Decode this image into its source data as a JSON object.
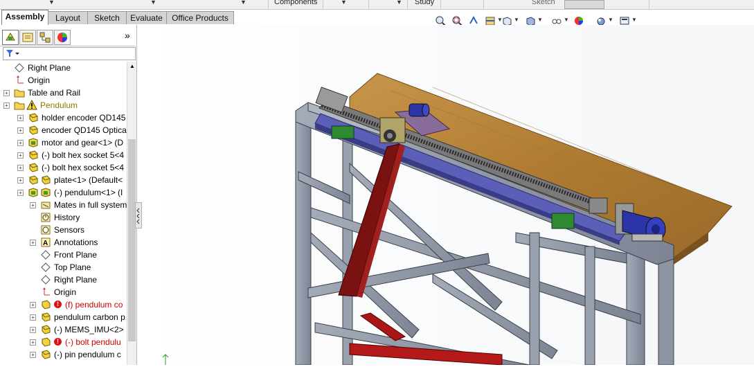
{
  "ribbon": {
    "groups": [
      "Components",
      "Study",
      "Sketch"
    ]
  },
  "tabs": [
    "Assembly",
    "Layout",
    "Sketch",
    "Evaluate",
    "Office Products"
  ],
  "panel": {
    "collapse_glyph": "»",
    "tabs": [
      "feature-manager",
      "property-manager",
      "configuration-manager",
      "display-manager"
    ]
  },
  "tree": [
    {
      "label": "Right Plane",
      "icon": "plane-icon"
    },
    {
      "label": "Origin",
      "icon": "origin-icon"
    },
    {
      "label": "Table and Rail",
      "icon": "folder-icon"
    },
    {
      "label": "Pendulum",
      "icon": "warning-icon"
    },
    {
      "label": "holder encoder QD145",
      "icon": "part-icon"
    },
    {
      "label": "encoder QD145 Optica",
      "icon": "part-icon"
    },
    {
      "label": "motor and gear<1> (D",
      "icon": "assembly-icon"
    },
    {
      "label": "(-) bolt hex socket 5<4",
      "icon": "part-icon"
    },
    {
      "label": "(-) bolt hex socket 5<4",
      "icon": "part-icon"
    },
    {
      "label": "plate<1> (Default<",
      "icon": "part-icon"
    },
    {
      "label": "(-) pendulum<1> (I",
      "icon": "assembly-icon"
    },
    {
      "label": "Mates in full system",
      "icon": "mates-icon"
    },
    {
      "label": "History",
      "icon": "history-icon"
    },
    {
      "label": "Sensors",
      "icon": "sensor-icon"
    },
    {
      "label": "Annotations",
      "icon": "annotation-icon"
    },
    {
      "label": "Front Plane",
      "icon": "plane-icon"
    },
    {
      "label": "Top Plane",
      "icon": "plane-icon"
    },
    {
      "label": "Right Plane",
      "icon": "plane-icon"
    },
    {
      "label": "Origin",
      "icon": "origin-icon"
    },
    {
      "label": "(f) pendulum co",
      "icon": "error-icon"
    },
    {
      "label": "pendulum carbon p",
      "icon": "part-icon"
    },
    {
      "label": "(-) MEMS_IMU<2>",
      "icon": "part-icon"
    },
    {
      "label": "(-) bolt pendulu",
      "icon": "error-icon"
    },
    {
      "label": "(-) pin pendulum c",
      "icon": "part-icon"
    }
  ],
  "hud_icons": [
    "zoom-to-fit-icon",
    "zoom-area-icon",
    "previous-view-icon",
    "section-view-icon",
    "view-orientation-icon",
    "display-style-icon",
    "hide-show-icon",
    "appearance-icon",
    "scene-icon",
    "view-settings-icon"
  ],
  "colors": {
    "warning_text": "#8a7a00",
    "error_text": "#cc0000",
    "wood": "#b8863a",
    "frame": "#8e96a6",
    "motor_blue": "#2b35a8",
    "pendulum_red": "#7a1212"
  }
}
